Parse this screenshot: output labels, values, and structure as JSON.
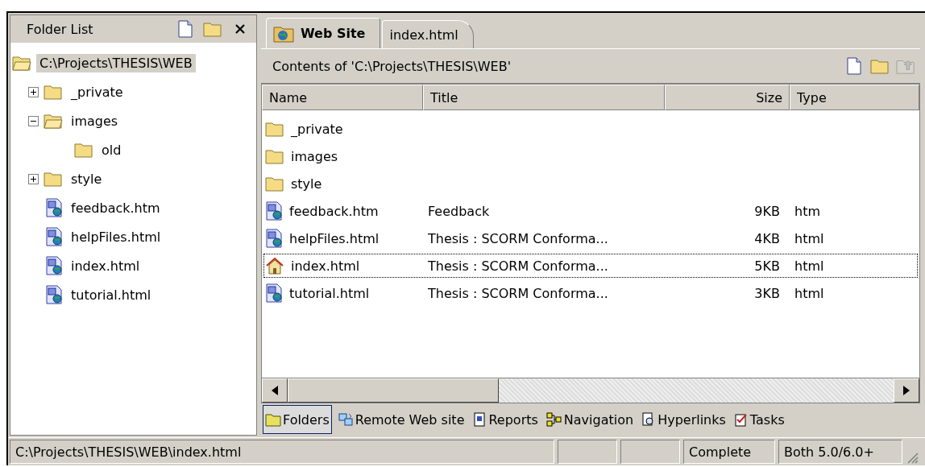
{
  "folder_list": {
    "title": "Folder List",
    "tree": [
      {
        "label": "C:\\Projects\\THESIS\\WEB",
        "kind": "root",
        "selected": true,
        "children": [
          {
            "label": "_private",
            "kind": "folder",
            "selected": false,
            "expanded": false
          },
          {
            "label": "images",
            "kind": "folder",
            "selected": false,
            "expanded": true,
            "children": [
              {
                "label": "old",
                "kind": "folder",
                "selected": false
              }
            ]
          },
          {
            "label": "style",
            "kind": "folder",
            "selected": false,
            "expanded": false
          },
          {
            "label": "feedback.htm",
            "kind": "page",
            "selected": false
          },
          {
            "label": "helpFiles.html",
            "kind": "page",
            "selected": false
          },
          {
            "label": "index.html",
            "kind": "page",
            "selected": false
          },
          {
            "label": "tutorial.html",
            "kind": "page",
            "selected": false
          }
        ]
      }
    ]
  },
  "tabs": [
    {
      "label": "Web Site",
      "selected": true
    },
    {
      "label": "index.html",
      "selected": false
    }
  ],
  "contents_bar": {
    "title": "Contents of 'C:\\Projects\\THESIS\\WEB'"
  },
  "columns": [
    "Name",
    "Title",
    "Size",
    "Type"
  ],
  "rows": [
    {
      "kind": "folder",
      "name": "_private",
      "focused": false
    },
    {
      "kind": "folder",
      "name": "images",
      "focused": false
    },
    {
      "kind": "folder",
      "name": "style",
      "focused": false
    },
    {
      "kind": "page",
      "name": "feedback.htm",
      "title": "Feedback",
      "size": "9KB",
      "type": "htm",
      "focused": false
    },
    {
      "kind": "page",
      "name": "helpFiles.html",
      "title": "Thesis : SCORM Conforma...",
      "size": "4KB",
      "type": "html",
      "focused": false
    },
    {
      "kind": "home",
      "name": "index.html",
      "title": "Thesis : SCORM Conforma...",
      "size": "5KB",
      "type": "html",
      "focused": true
    },
    {
      "kind": "page",
      "name": "tutorial.html",
      "title": "Thesis : SCORM Conforma...",
      "size": "3KB",
      "type": "html",
      "focused": false
    }
  ],
  "view_bar": [
    {
      "kind": "folders",
      "label": "Folders",
      "selected": true
    },
    {
      "kind": "remote",
      "label": "Remote Web site",
      "selected": false
    },
    {
      "kind": "reports",
      "label": "Reports",
      "selected": false
    },
    {
      "kind": "navigation",
      "label": "Navigation",
      "selected": false
    },
    {
      "kind": "hyperlinks",
      "label": "Hyperlinks",
      "selected": false
    },
    {
      "kind": "tasks",
      "label": "Tasks",
      "selected": false
    }
  ],
  "status_bar": {
    "path": "C:\\Projects\\THESIS\\WEB\\index.html",
    "status": "Complete",
    "compatibility": "Both 5.0/6.0+"
  }
}
